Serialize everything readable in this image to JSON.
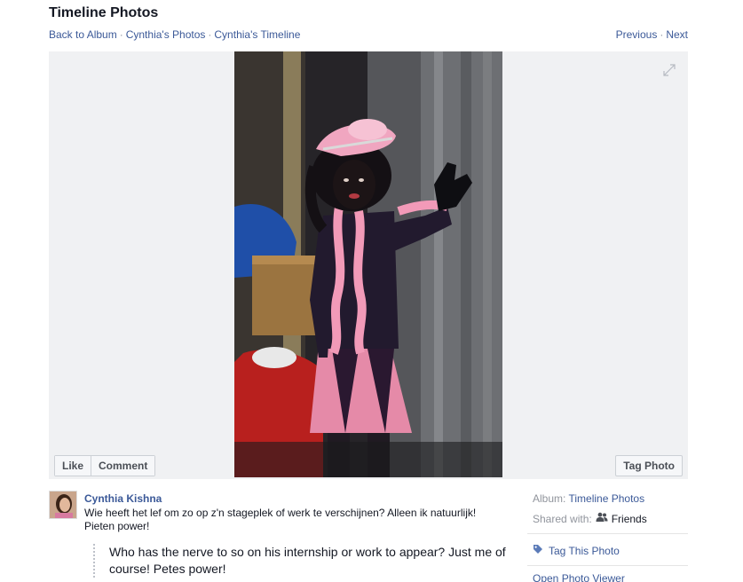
{
  "header": {
    "title": "Timeline Photos",
    "breadcrumbs": [
      "Back to Album",
      "Cynthia's Photos",
      "Cynthia's Timeline"
    ],
    "separator": "·",
    "previous": "Previous",
    "next": "Next"
  },
  "photo_actions": {
    "like": "Like",
    "comment": "Comment",
    "tag_photo": "Tag Photo"
  },
  "post": {
    "author": "Cynthia Kishna",
    "text": "Wie heeft het lef om zo op z'n stageplek of werk te verschijnen? Alleen ik natuurlijk! Pieten power!",
    "translation": "Who has the nerve to so on his internship or work to appear? Just me of course! Petes power!"
  },
  "sidebar": {
    "album_label": "Album:",
    "album_value": "Timeline Photos",
    "shared_label": "Shared with:",
    "shared_value": "Friends",
    "tag_this_photo": "Tag This Photo",
    "open_viewer": "Open Photo Viewer"
  },
  "colors": {
    "link": "#3b5998",
    "stage_bg": "#f0f1f3",
    "muted": "#90949c"
  }
}
